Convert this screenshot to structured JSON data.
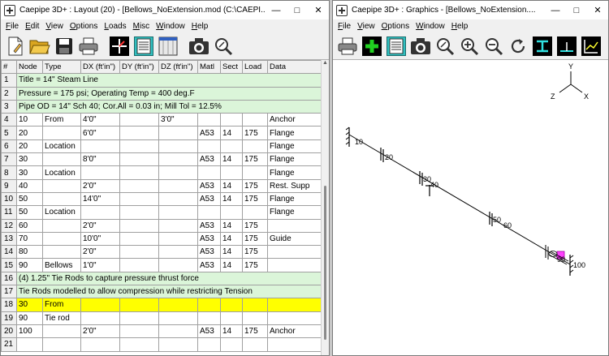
{
  "layout_window": {
    "title": "Caepipe 3D+ : Layout  (20)  - [Bellows_NoExtension.mod (C:\\CAEPI...",
    "menus": [
      "File",
      "Edit",
      "View",
      "Options",
      "Loads",
      "Misc",
      "Window",
      "Help"
    ],
    "toolbar_icons": [
      "new-file-icon",
      "open-folder-icon",
      "save-icon",
      "print-icon",
      "graphics-icon",
      "list-icon",
      "window-icon",
      "camera-icon",
      "zoom-icon"
    ],
    "columns": [
      "#",
      "Node",
      "Type",
      "DX (ft'in\")",
      "DY (ft'in\")",
      "DZ (ft'in\")",
      "Matl",
      "Sect",
      "Load",
      "Data"
    ],
    "rows": [
      {
        "n": "1",
        "kind": "comment",
        "text": "Title = 14\" Steam Line"
      },
      {
        "n": "2",
        "kind": "comment",
        "text": "Pressure = 175 psi; Operating Temp = 400 deg.F"
      },
      {
        "n": "3",
        "kind": "comment",
        "text": "Pipe OD = 14\" Sch 40; Cor.All = 0.03 in; Mill Tol = 12.5%"
      },
      {
        "n": "4",
        "kind": "data",
        "cells": [
          "10",
          "From",
          "4'0\"",
          "",
          "3'0\"",
          "",
          "",
          "",
          "Anchor"
        ]
      },
      {
        "n": "5",
        "kind": "data",
        "cells": [
          "20",
          "",
          "6'0\"",
          "",
          "",
          "A53",
          "14",
          "175",
          "Flange"
        ]
      },
      {
        "n": "6",
        "kind": "data",
        "cells": [
          "20",
          "Location",
          "",
          "",
          "",
          "",
          "",
          "",
          "Flange"
        ]
      },
      {
        "n": "7",
        "kind": "data",
        "cells": [
          "30",
          "",
          "8'0\"",
          "",
          "",
          "A53",
          "14",
          "175",
          "Flange"
        ]
      },
      {
        "n": "8",
        "kind": "data",
        "cells": [
          "30",
          "Location",
          "",
          "",
          "",
          "",
          "",
          "",
          "Flange"
        ]
      },
      {
        "n": "9",
        "kind": "data",
        "cells": [
          "40",
          "",
          "2'0\"",
          "",
          "",
          "A53",
          "14",
          "175",
          "Rest. Supp"
        ]
      },
      {
        "n": "10",
        "kind": "data",
        "cells": [
          "50",
          "",
          "14'0\"",
          "",
          "",
          "A53",
          "14",
          "175",
          "Flange"
        ]
      },
      {
        "n": "11",
        "kind": "data",
        "cells": [
          "50",
          "Location",
          "",
          "",
          "",
          "",
          "",
          "",
          "Flange"
        ]
      },
      {
        "n": "12",
        "kind": "data",
        "cells": [
          "60",
          "",
          "2'0\"",
          "",
          "",
          "A53",
          "14",
          "175",
          ""
        ]
      },
      {
        "n": "13",
        "kind": "data",
        "cells": [
          "70",
          "",
          "10'0\"",
          "",
          "",
          "A53",
          "14",
          "175",
          "Guide"
        ]
      },
      {
        "n": "14",
        "kind": "data",
        "cells": [
          "80",
          "",
          "2'0\"",
          "",
          "",
          "A53",
          "14",
          "175",
          ""
        ]
      },
      {
        "n": "15",
        "kind": "data",
        "cells": [
          "90",
          "Bellows",
          "1'0\"",
          "",
          "",
          "A53",
          "14",
          "175",
          ""
        ]
      },
      {
        "n": "16",
        "kind": "comment",
        "text": "(4) 1.25\" Tie Rods to capture pressure thrust force"
      },
      {
        "n": "17",
        "kind": "comment",
        "text": "Tie Rods modelled to allow compression while restricting Tension"
      },
      {
        "n": "18",
        "kind": "selected",
        "cells": [
          "30",
          "From",
          "",
          "",
          "",
          "",
          "",
          "",
          ""
        ]
      },
      {
        "n": "19",
        "kind": "data",
        "cells": [
          "90",
          "Tie rod",
          "",
          "",
          "",
          "",
          "",
          "",
          ""
        ]
      },
      {
        "n": "20",
        "kind": "data",
        "cells": [
          "100",
          "",
          "2'0\"",
          "",
          "",
          "A53",
          "14",
          "175",
          "Anchor"
        ]
      },
      {
        "n": "21",
        "kind": "data",
        "cells": [
          "",
          "",
          "",
          "",
          "",
          "",
          "",
          "",
          ""
        ]
      }
    ]
  },
  "graphics_window": {
    "title": "Caepipe 3D+ : Graphics - [Bellows_NoExtension....",
    "menus": [
      "File",
      "View",
      "Options",
      "Window",
      "Help"
    ],
    "toolbar_icons": [
      "print-icon",
      "add-icon",
      "list-icon",
      "camera-icon",
      "zoom-icon",
      "zoom-in-icon",
      "zoom-out-icon",
      "rotate-icon",
      "anchor-view-icon",
      "node-view-icon",
      "plot-icon"
    ],
    "axes": {
      "y": "Y",
      "z": "Z",
      "x": "X"
    },
    "node_labels": [
      "10",
      "20",
      "30",
      "40",
      "50",
      "60",
      "90",
      "100"
    ]
  }
}
